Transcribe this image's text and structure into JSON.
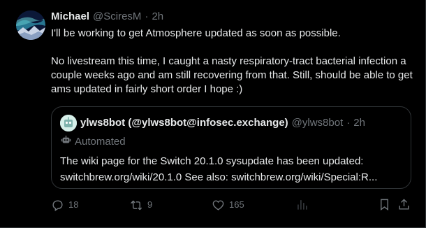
{
  "tweet": {
    "author_name": "Michael",
    "author_handle": "@SciresM",
    "separator": "·",
    "time": "2h",
    "paragraph1": "I'll be working to get Atmosphere updated as soon as possible.",
    "paragraph2": "No livestream this time, I caught a nasty respiratory-tract bacterial infection a couple weeks ago and am still recovering from that. Still, should be able to get ams updated in fairly short order I hope :)"
  },
  "quote": {
    "author_name": "ylws8bot (@ylws8bot@infosec.exchange)",
    "author_handle": "@ylws8bot",
    "separator": "·",
    "time": "2h",
    "automated_label": "Automated",
    "line1": "The wiki page for the  Switch 20.1.0 sysupdate has been updated:",
    "line2": "switchbrew.org/wiki/20.1.0 See also: switchbrew.org/wiki/Special:R..."
  },
  "actions": {
    "replies": "18",
    "reposts": "9",
    "likes": "165"
  },
  "icons": [
    "reply-icon",
    "repost-icon",
    "like-icon",
    "views-icon",
    "bookmark-icon",
    "share-icon",
    "bot-icon"
  ],
  "colors": {
    "background": "#000000",
    "text": "#e7e9ea",
    "muted": "#71767b",
    "border": "#2f3336"
  }
}
